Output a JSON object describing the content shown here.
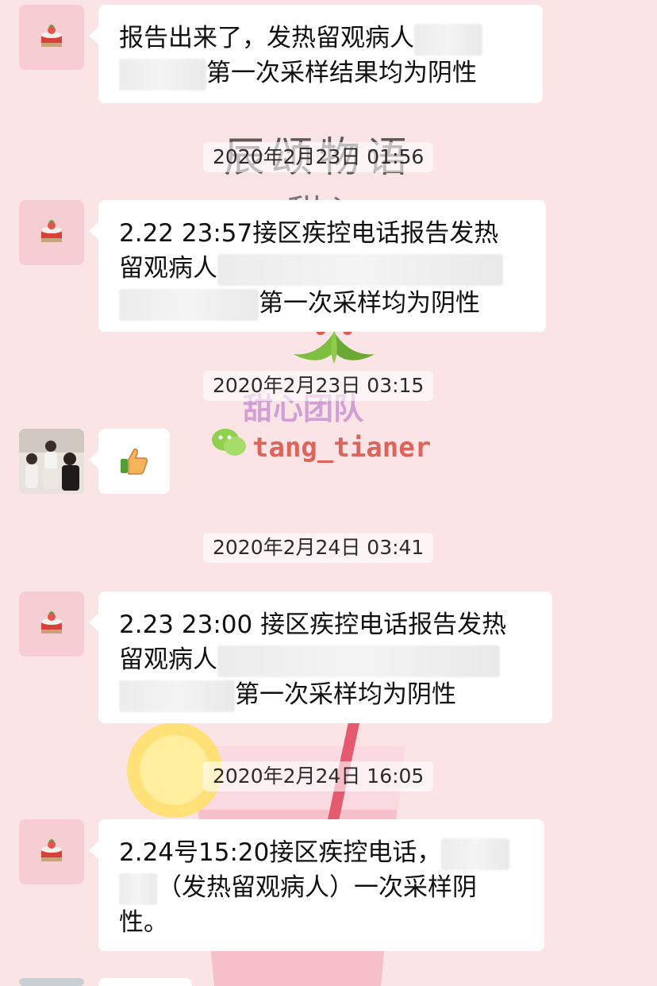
{
  "wallpaper": {
    "title_text": "辰颂物语",
    "subtitle_text": "甜心",
    "team_text": "甜心团队",
    "handle": "tang_tianer"
  },
  "colors": {
    "background": "#fbe4e6",
    "bubble": "#ffffff",
    "avatar_bg": "#f6cdd2"
  },
  "messages": [
    {
      "avatar_icon": "strawberry-cake-icon",
      "line1": "报告出来了，发热留观病人",
      "line2": "第一次采样结果均为阴性"
    },
    {
      "timestamp": "2020年2月23日 01:56",
      "avatar_icon": "strawberry-cake-icon",
      "line1": "2.22 23:57接区疾控电话报告发热",
      "line2": "留观病人",
      "line3": "第一次采样均为阴性"
    },
    {
      "timestamp": "2020年2月23日 03:15",
      "avatar_icon": "family-photo-avatar",
      "emoji": "👍",
      "emoji_icon": "thumbs-up-icon"
    },
    {
      "timestamp": "2020年2月24日 03:41",
      "avatar_icon": "strawberry-cake-icon",
      "line1": "2.23 23:00 接区疾控电话报告发热",
      "line2": "留观病人",
      "line3": "第一次采样均为阴性"
    },
    {
      "timestamp": "2020年2月24日 16:05",
      "avatar_icon": "strawberry-cake-icon",
      "line1": "2.24号15:20接区疾控电话，",
      "line2": "（发热留观病人）一次采样阴",
      "line3": "性。"
    }
  ]
}
